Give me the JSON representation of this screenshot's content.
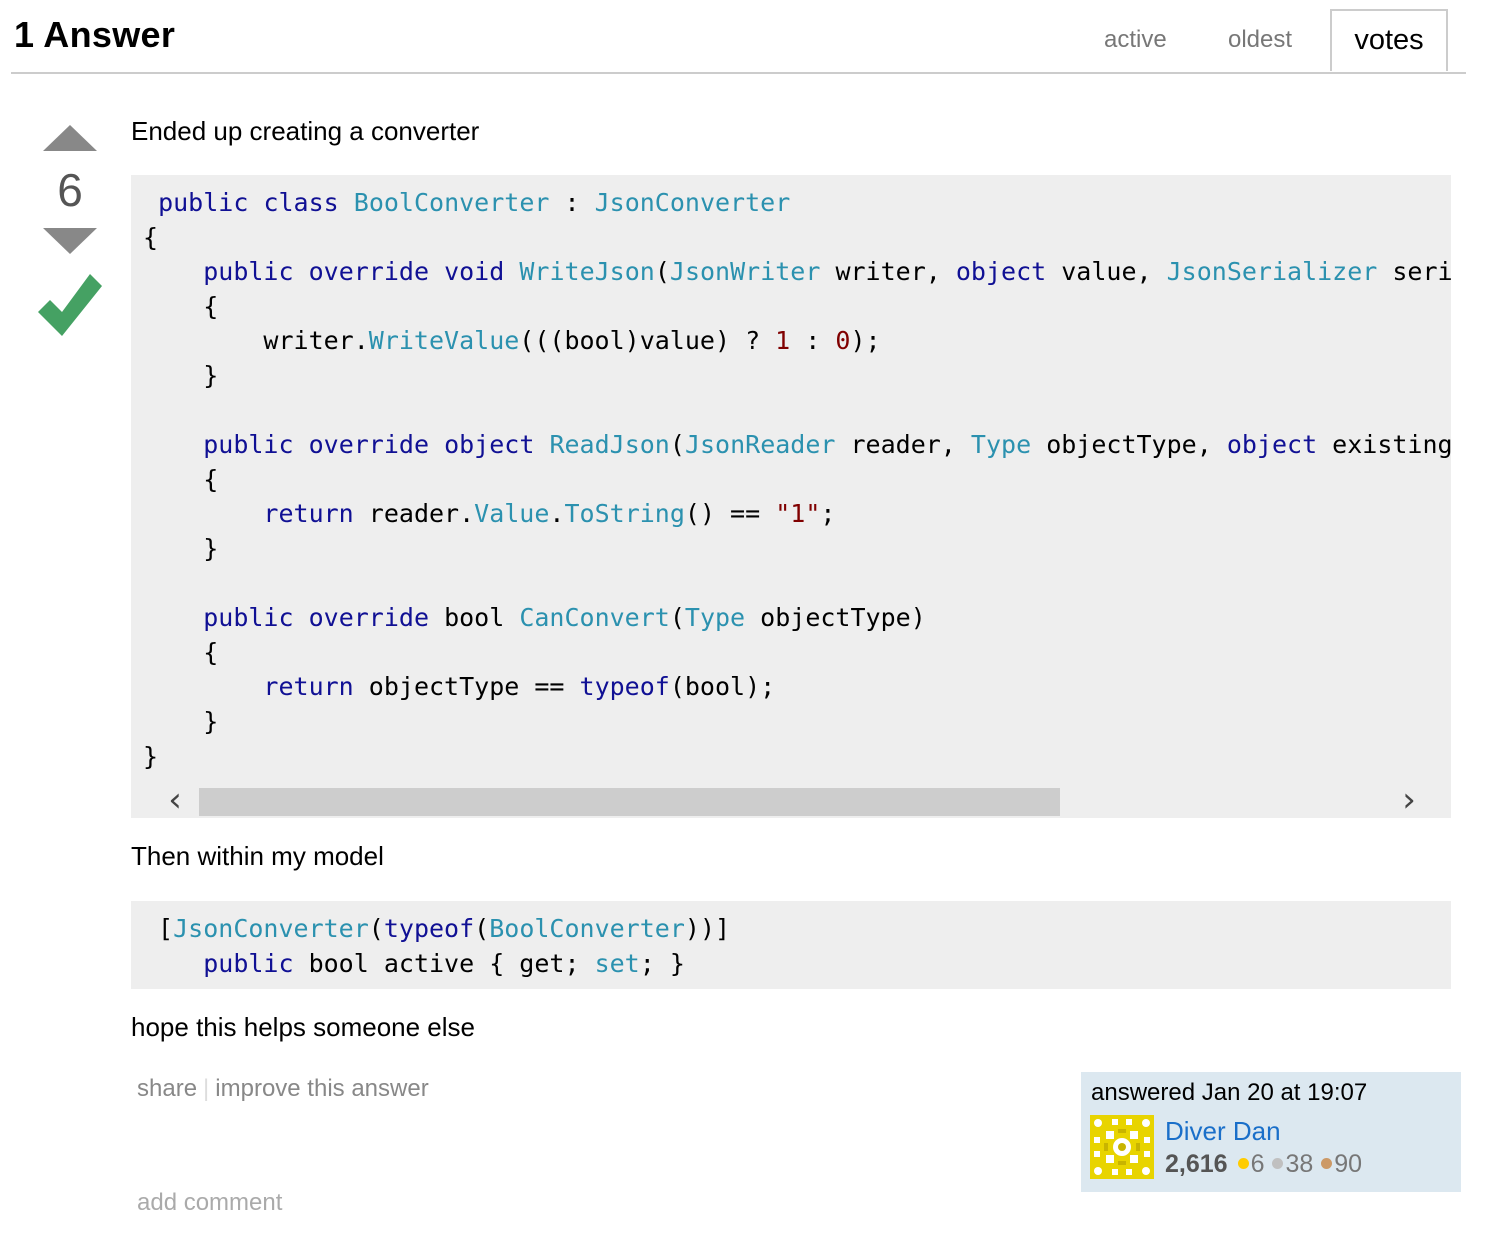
{
  "header": {
    "title": "1 Answer",
    "tabs": [
      "active",
      "oldest",
      "votes"
    ]
  },
  "vote": {
    "count": "6"
  },
  "post": {
    "p1": "Ended up creating a converter",
    "p2": "Then within my model",
    "p3": "hope this helps someone else"
  },
  "menu": {
    "share": "share",
    "sep": "|",
    "improve": "improve this answer"
  },
  "add_comment": "add comment",
  "signature": {
    "action": "answered Jan 20 at 19:07",
    "name": "Diver Dan",
    "rep": "2,616",
    "gold": "6",
    "silver": "38",
    "bronze": "90"
  },
  "icons": {
    "upvote": "triangle-up-icon",
    "downvote": "triangle-down-icon",
    "accepted": "checkmark-icon",
    "scroll_left": "chevron-left-icon",
    "scroll_right": "chevron-right-icon"
  },
  "colors": {
    "keyword": "#101094",
    "type": "#2b91af",
    "literal": "#800000",
    "accepted": "#45a163",
    "link": "#1a6fc9",
    "code_bg": "#eeeeee",
    "signature_bg": "#dce8f0"
  }
}
